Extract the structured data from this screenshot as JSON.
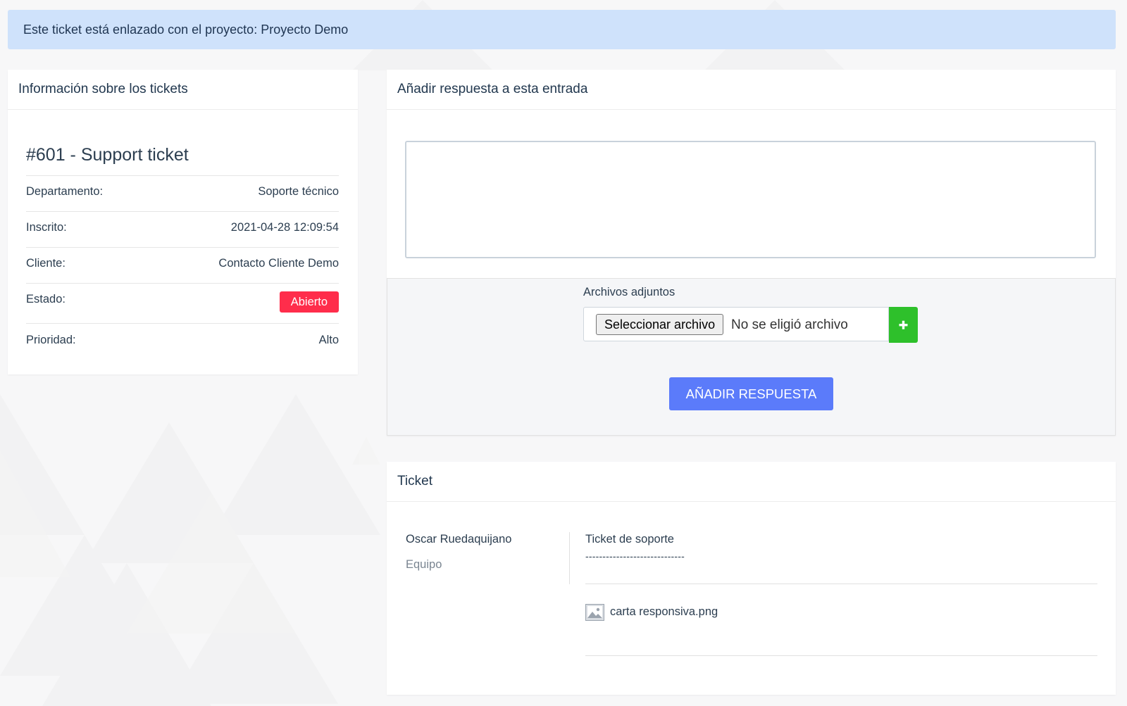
{
  "alert": {
    "text": "Este ticket está enlazado con el proyecto: Proyecto Demo"
  },
  "info_panel": {
    "heading": "Información sobre los tickets",
    "ticket_title": "#601 - Support ticket",
    "rows": [
      {
        "label": "Departamento:",
        "value": "Soporte técnico"
      },
      {
        "label": "Inscrito:",
        "value": "2021-04-28 12:09:54"
      },
      {
        "label": "Cliente:",
        "value": "Contacto Cliente Demo"
      },
      {
        "label": "Estado:",
        "value": "Abierto"
      },
      {
        "label": "Prioridad:",
        "value": "Alto"
      }
    ],
    "status_color": "#ff2d4b"
  },
  "reply_panel": {
    "heading": "Añadir respuesta a esta entrada",
    "textarea_value": "",
    "attachments_label": "Archivos adjuntos",
    "file_button": "Seleccionar archivo",
    "file_status": "No se eligió archivo",
    "add_icon": "plus-icon",
    "submit_label": "AÑADIR RESPUESTA",
    "accent_color": "#5b7bfa",
    "add_color": "#2ec02b"
  },
  "ticket_panel": {
    "heading": "Ticket",
    "author": "Oscar Ruedaquijano",
    "role": "Equipo",
    "message": "Ticket de soporte",
    "separator": "-----------------------------",
    "attachment_icon": "image-file-icon",
    "attachment_name": "carta responsiva.png"
  }
}
